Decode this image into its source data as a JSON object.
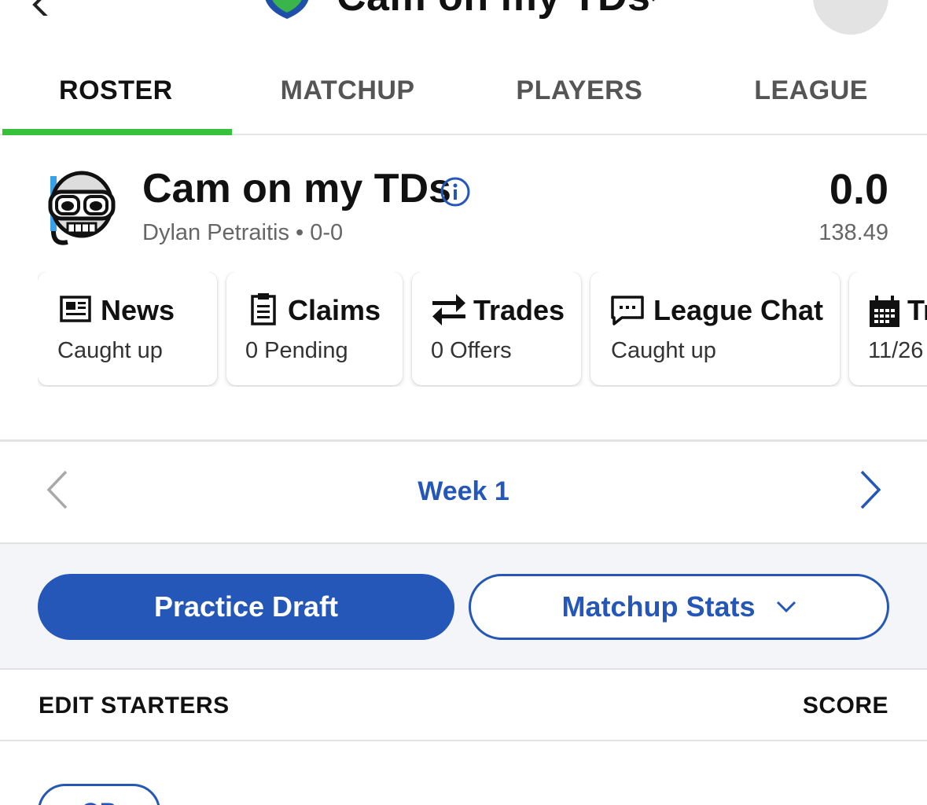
{
  "header": {
    "league_title": "Cam on my TDs",
    "icons": {
      "back": "chevron-left-icon",
      "logo": "shield-logo-icon",
      "caret": "chevron-down-icon",
      "chat": "chat-bubble-icon"
    }
  },
  "tabs": [
    {
      "label": "ROSTER",
      "active": true
    },
    {
      "label": "MATCHUP",
      "active": false
    },
    {
      "label": "PLAYERS",
      "active": false
    },
    {
      "label": "LEAGUE",
      "active": false
    }
  ],
  "team": {
    "name": "Cam on my TDs",
    "owner_record": "Dylan Petraitis • 0-0",
    "score": "0.0",
    "projected": "138.49",
    "avatar_icon": "skull-snorkel-icon",
    "info_icon": "info-icon"
  },
  "cards": [
    {
      "title": "News",
      "subtitle": "Caught up",
      "icon": "newspaper-icon"
    },
    {
      "title": "Claims",
      "subtitle": "0 Pending",
      "icon": "clipboard-icon"
    },
    {
      "title": "Trades",
      "subtitle": "0 Offers",
      "icon": "swap-arrows-icon"
    },
    {
      "title": "League Chat",
      "subtitle": "Caught up",
      "icon": "chat-dots-icon"
    },
    {
      "title": "Tr",
      "subtitle": "11/26",
      "icon": "calendar-icon"
    }
  ],
  "week_nav": {
    "label": "Week 1"
  },
  "actions": {
    "primary": "Practice Draft",
    "secondary": "Matchup Stats"
  },
  "table": {
    "left": "EDIT STARTERS",
    "right": "SCORE",
    "first_position": "QB"
  },
  "colors": {
    "accent": "#2457b8",
    "tab_indicator": "#35c13a",
    "band_bg": "#f3f5f8"
  }
}
